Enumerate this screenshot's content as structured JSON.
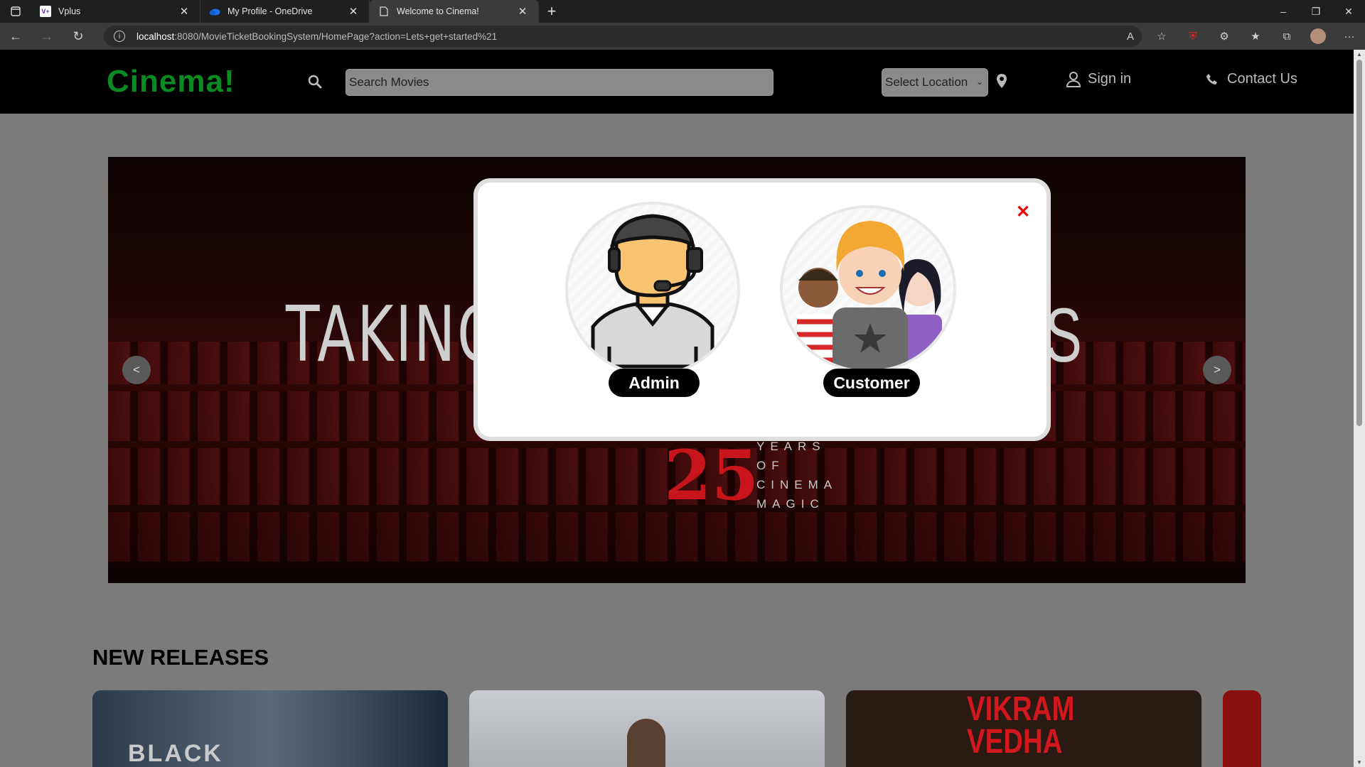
{
  "browser": {
    "tabs": [
      {
        "title": "Vplus",
        "favicon": "V+"
      },
      {
        "title": "My Profile - OneDrive",
        "favicon": "onedrive-icon"
      },
      {
        "title": "Welcome to Cinema!",
        "favicon": "page-icon"
      }
    ],
    "url_host": "localhost",
    "url_rest": ":8080/MovieTicketBookingSystem/HomePage?action=Lets+get+started%21"
  },
  "header": {
    "logo": "Cinema!",
    "search_placeholder": "Search Movies",
    "location_label": "Select Location",
    "signin_label": "Sign in",
    "contact_label": "Contact Us"
  },
  "banner": {
    "headline_left": "TAKING",
    "headline_right": "S",
    "badge_number": "25",
    "badge_lines": [
      "YEARS",
      "OF",
      "CINEMA",
      "MAGIC"
    ],
    "prev_label": "<",
    "next_label": ">"
  },
  "section": {
    "title": "NEW RELEASES",
    "movie_texts": [
      "BLACK",
      "VIKRAM",
      "VEDHA"
    ]
  },
  "modal": {
    "close_label": "✕",
    "admin_label": "Admin",
    "customer_label": "Customer"
  },
  "colors": {
    "logo": "#0a8a22",
    "close": "#e00000",
    "banner_red": "#c8151b"
  }
}
